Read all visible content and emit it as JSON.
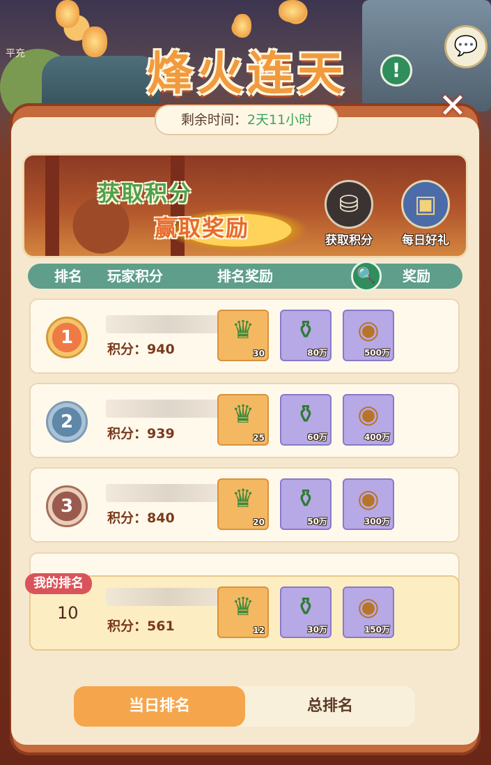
{
  "header": {
    "title": "烽火连天",
    "timer_label": "剩余时间：",
    "timer_value": "2天11小时",
    "bg_text": "平充"
  },
  "banner": {
    "slogan_line1": "获取积分",
    "slogan_line2": "赢取奖励",
    "earn_points_label": "获取积分",
    "daily_gift_label": "每日好礼"
  },
  "table_header": {
    "rank": "排名",
    "player_score": "玩家积分",
    "rank_reward": "排名奖励",
    "reward": "奖励"
  },
  "rows": [
    {
      "rank": "1",
      "score_text": "积分：940",
      "rewards": [
        "30",
        "80万",
        "500万"
      ]
    },
    {
      "rank": "2",
      "score_text": "积分：939",
      "rewards": [
        "25",
        "60万",
        "400万"
      ]
    },
    {
      "rank": "3",
      "score_text": "积分：840",
      "rewards": [
        "20",
        "50万",
        "300万"
      ]
    }
  ],
  "my_rank": {
    "tag": "我的排名",
    "rank": "10",
    "score_text": "积分：561",
    "rewards": [
      "12",
      "30万",
      "150万"
    ]
  },
  "tabs": {
    "daily": "当日排名",
    "total": "总排名"
  },
  "icons": {
    "info": "exclamation-icon",
    "chat": "chat-bubbles-icon",
    "close": "close-icon",
    "search": "magnifier-icon",
    "reward_1": "jade-dragon-icon",
    "reward_2": "green-bottle-icon",
    "reward_3": "copper-coin-icon"
  },
  "colors": {
    "accent_orange": "#f5a64c",
    "accent_green": "#5e9e8b",
    "panel": "#f6e8cf",
    "tag_red": "#d9545a"
  }
}
